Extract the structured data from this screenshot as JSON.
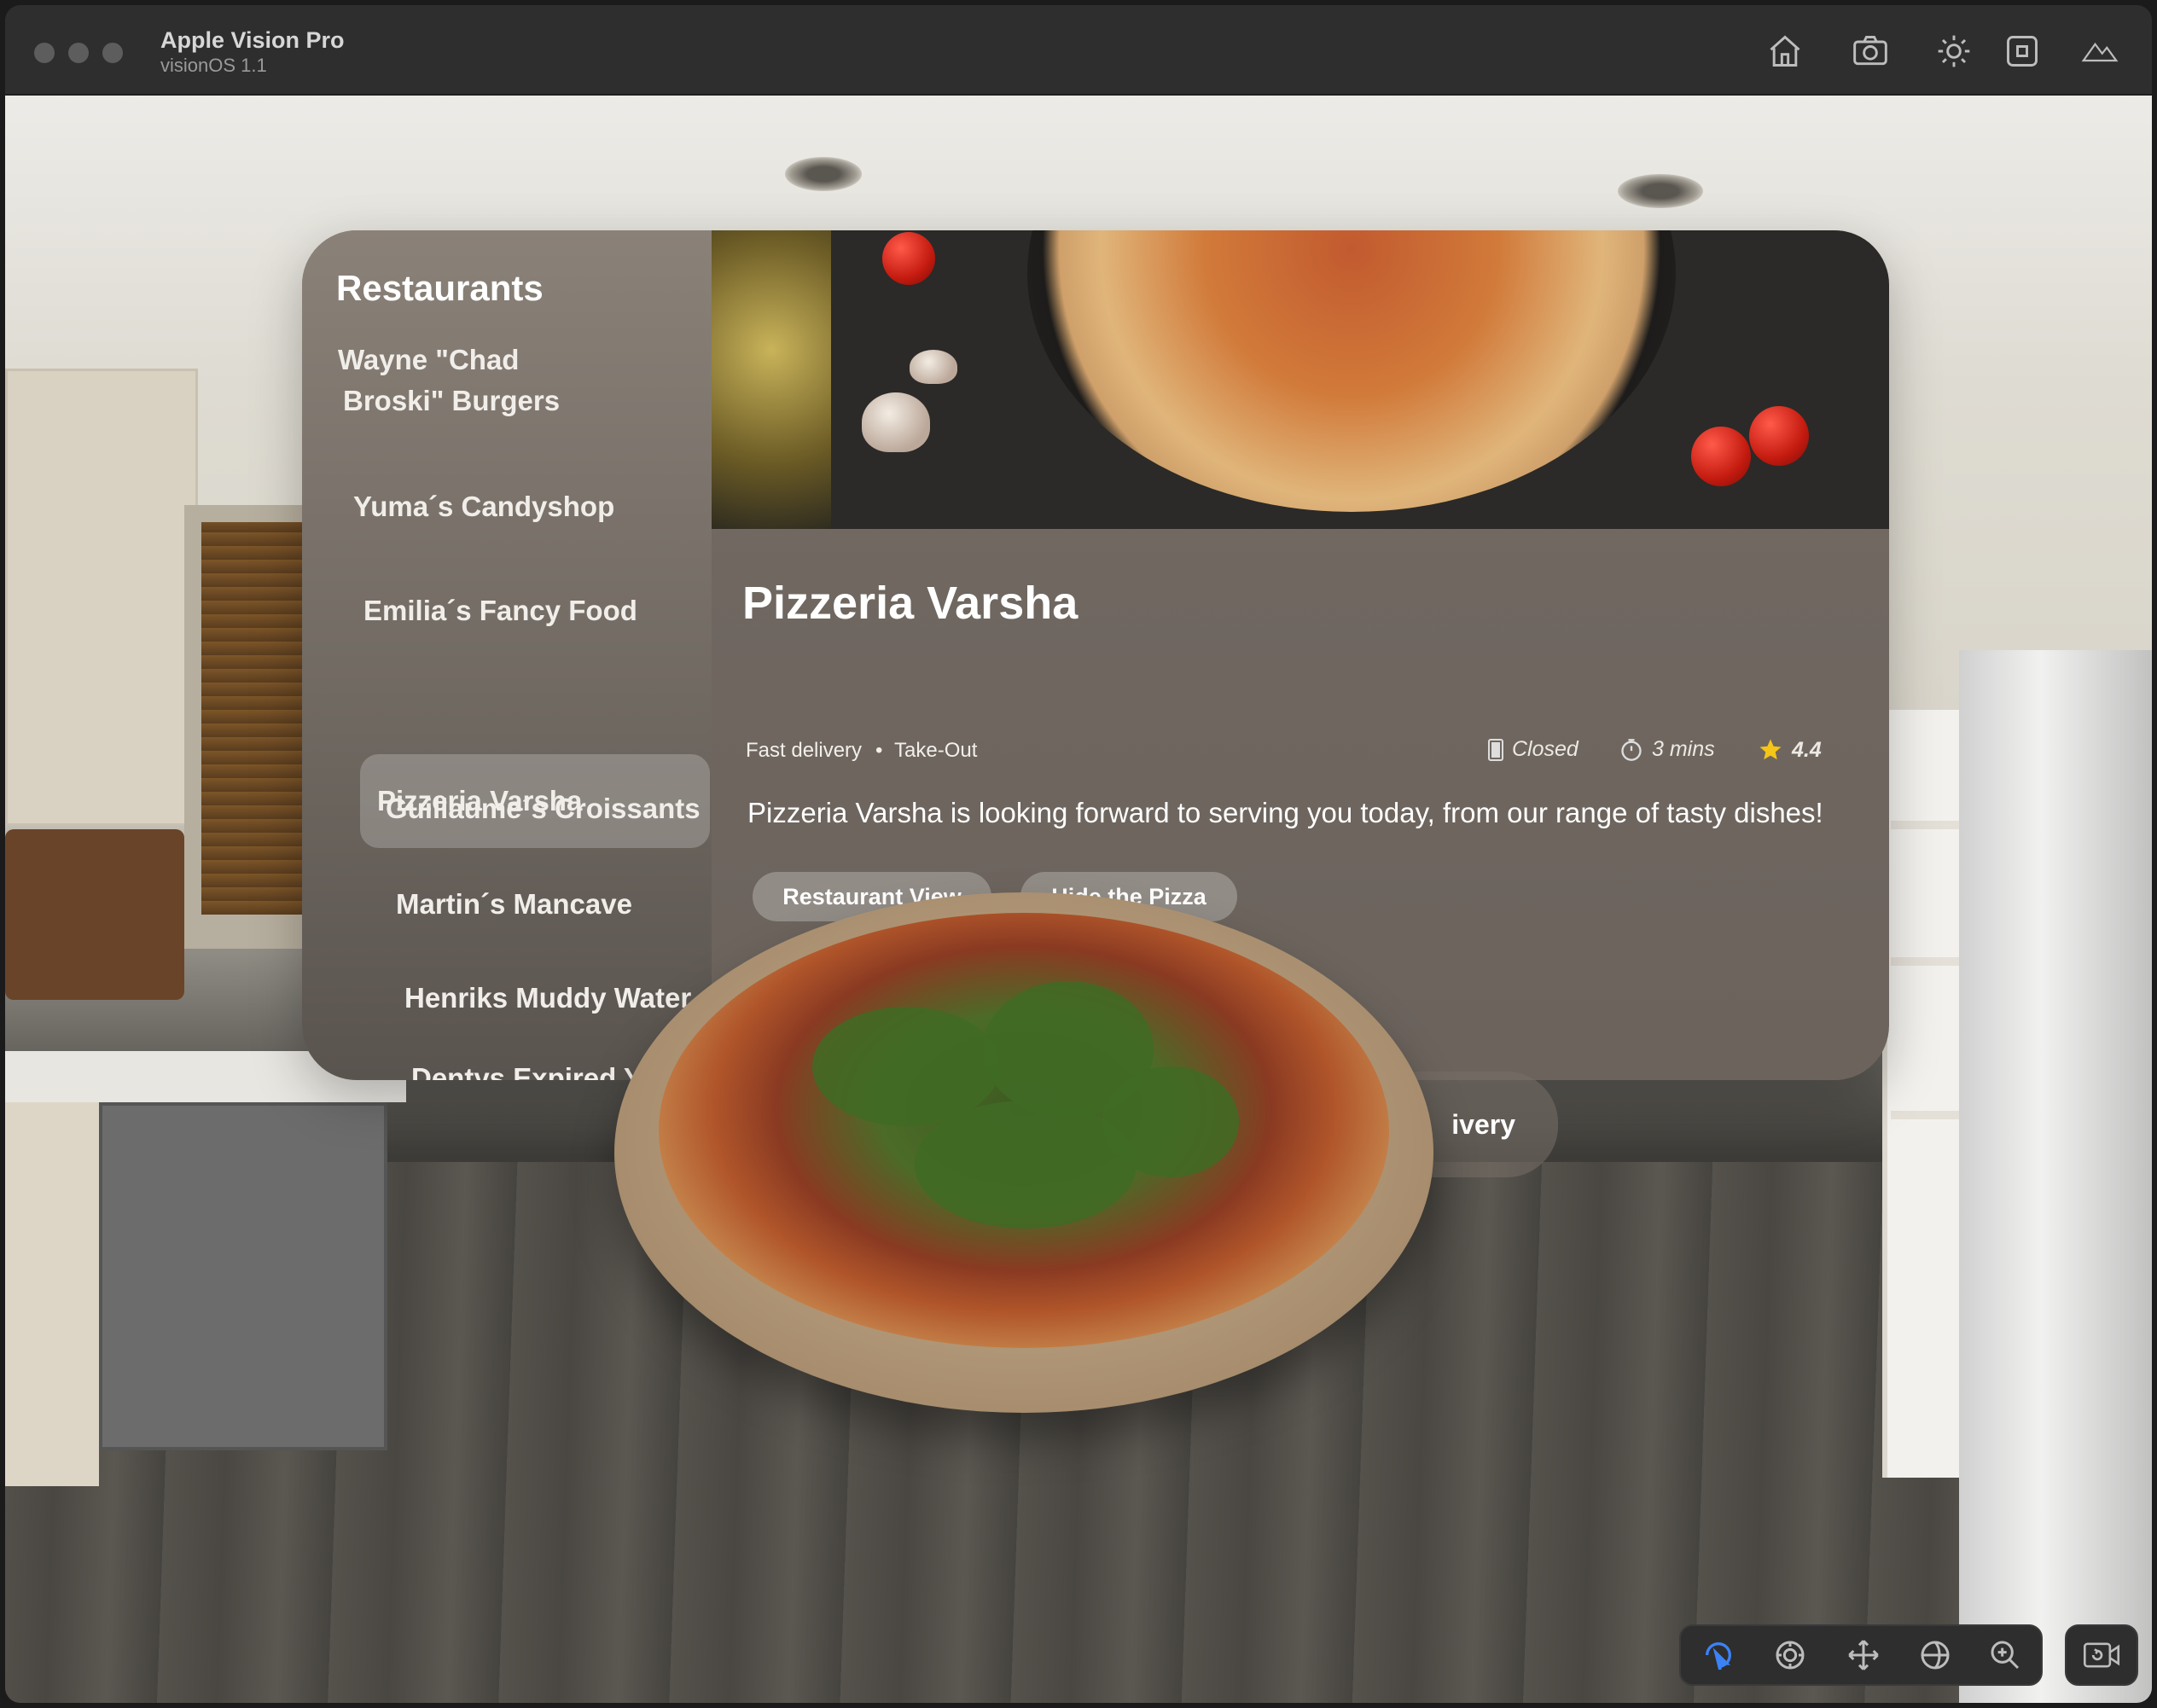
{
  "window": {
    "title": "Apple Vision Pro",
    "subtitle": "visionOS 1.1",
    "toolbar_icons": [
      "home-icon",
      "camera-icon",
      "brightness-icon",
      "keyboard-command-icon",
      "environment-icon"
    ]
  },
  "sidebar": {
    "title": "Restaurants",
    "items": [
      {
        "label": "Wayne \"Chad Broski\" Burgers",
        "line1": "Wayne \"Chad",
        "line2": "Broski\" Burgers"
      },
      {
        "label": "Yuma´s Candyshop"
      },
      {
        "label": "Emilia´s Fancy Food"
      },
      {
        "label": "Pizzeria Varsha",
        "selected": true
      },
      {
        "label": "Guillaume´s Croissants"
      },
      {
        "label": "Martin´s Mancave"
      },
      {
        "label": "Henriks Muddy Water"
      },
      {
        "label": "Dentys Expired Yo..."
      }
    ]
  },
  "detail": {
    "title": "Pizzeria Varsha",
    "tags": [
      "Fast delivery",
      "Take-Out"
    ],
    "separator": "•",
    "status": "Closed",
    "time": "3 mins",
    "rating": "4.4",
    "description": "Pizzeria Varsha is looking forward to serving you today, from our range of tasty dishes!",
    "buttons": {
      "restaurant_view": "Restaurant View",
      "hide_pizza": "Hide the Pizza"
    }
  },
  "ornament": {
    "partial_label": "ivery"
  },
  "bottom_toolbar": {
    "tools": [
      "pointer-icon",
      "look-icon",
      "move-icon",
      "orbit-icon",
      "zoom-icon"
    ],
    "active_tool": "pointer-icon",
    "capture": "camera-reset-icon"
  },
  "colors": {
    "accent": "#3b82f6",
    "star": "#f5c518"
  }
}
